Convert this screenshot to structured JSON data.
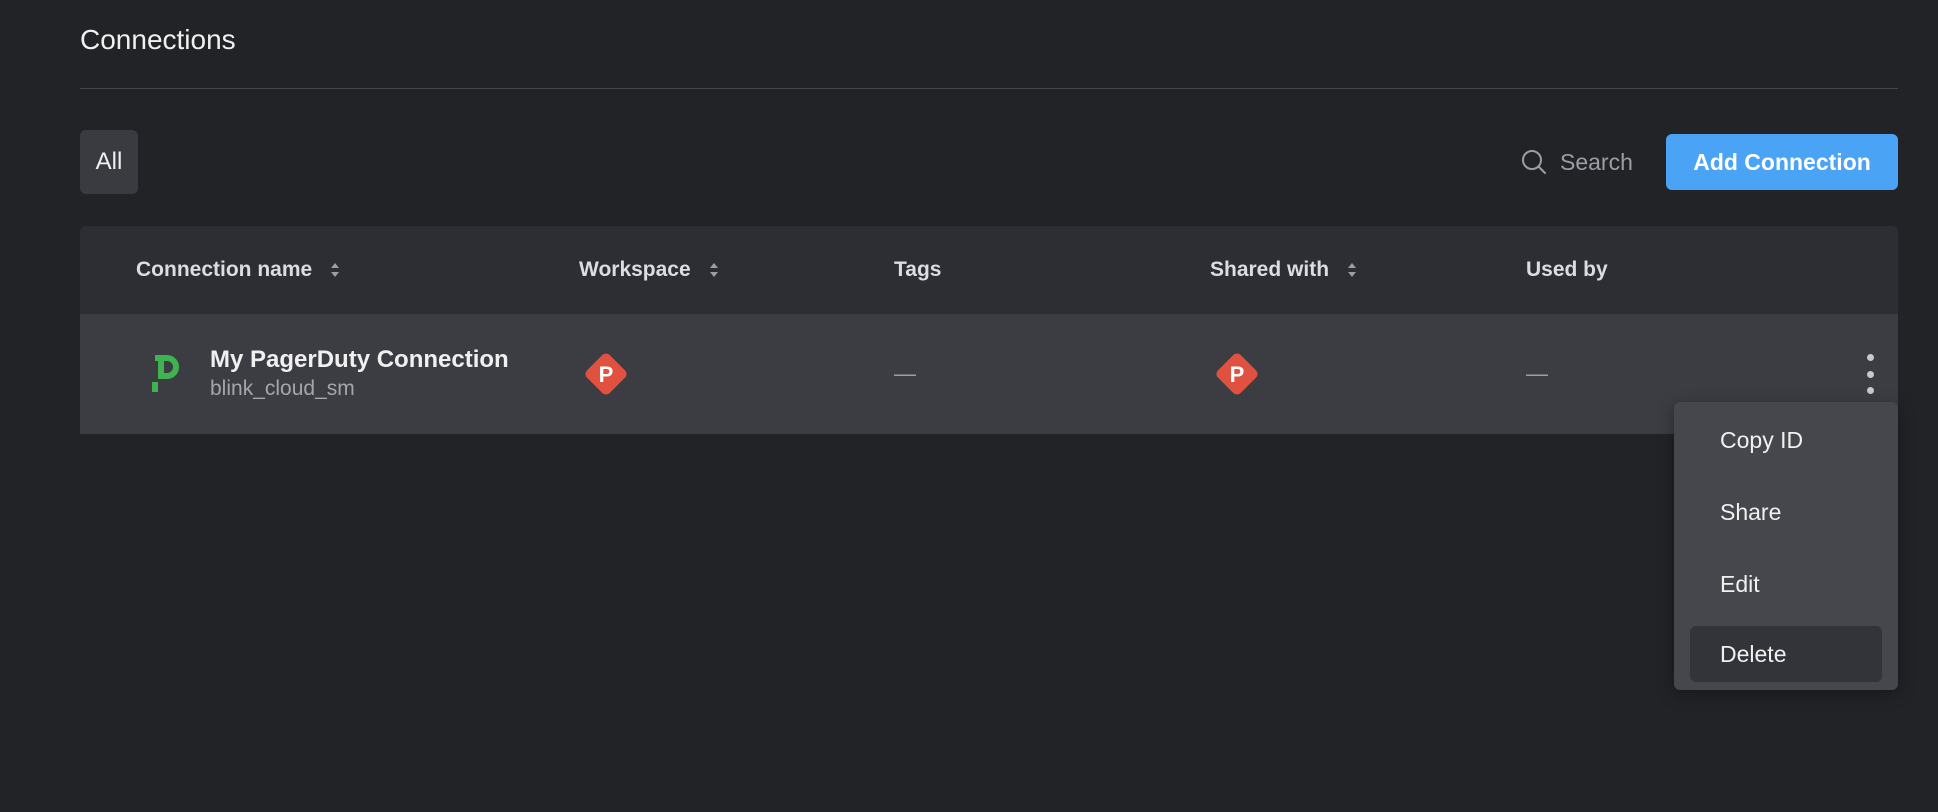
{
  "header": {
    "title": "Connections"
  },
  "toolbar": {
    "filters": [
      {
        "label": "All",
        "selected": true
      }
    ],
    "search": {
      "placeholder": "Search"
    },
    "add_button_label": "Add Connection"
  },
  "table": {
    "columns": [
      {
        "label": "Connection name",
        "sortable": true
      },
      {
        "label": "Workspace",
        "sortable": true
      },
      {
        "label": "Tags",
        "sortable": false
      },
      {
        "label": "Shared with",
        "sortable": true
      },
      {
        "label": "Used by",
        "sortable": false
      }
    ],
    "rows": [
      {
        "icon": "pagerduty-logo-icon",
        "name": "My PagerDuty Connection",
        "subtitle": "blink_cloud_sm",
        "workspace_badge": "P",
        "tags": "—",
        "shared_with_badge": "P",
        "used_by": "—"
      }
    ]
  },
  "context_menu": {
    "items": [
      {
        "label": "Copy ID"
      },
      {
        "label": "Share"
      },
      {
        "label": "Edit"
      },
      {
        "label": "Delete",
        "highlighted": true
      }
    ]
  },
  "colors": {
    "background": "#222327",
    "accent": "#4aa3f5",
    "pagerduty_green": "#3fb34f",
    "badge_red": "#e0523f"
  }
}
